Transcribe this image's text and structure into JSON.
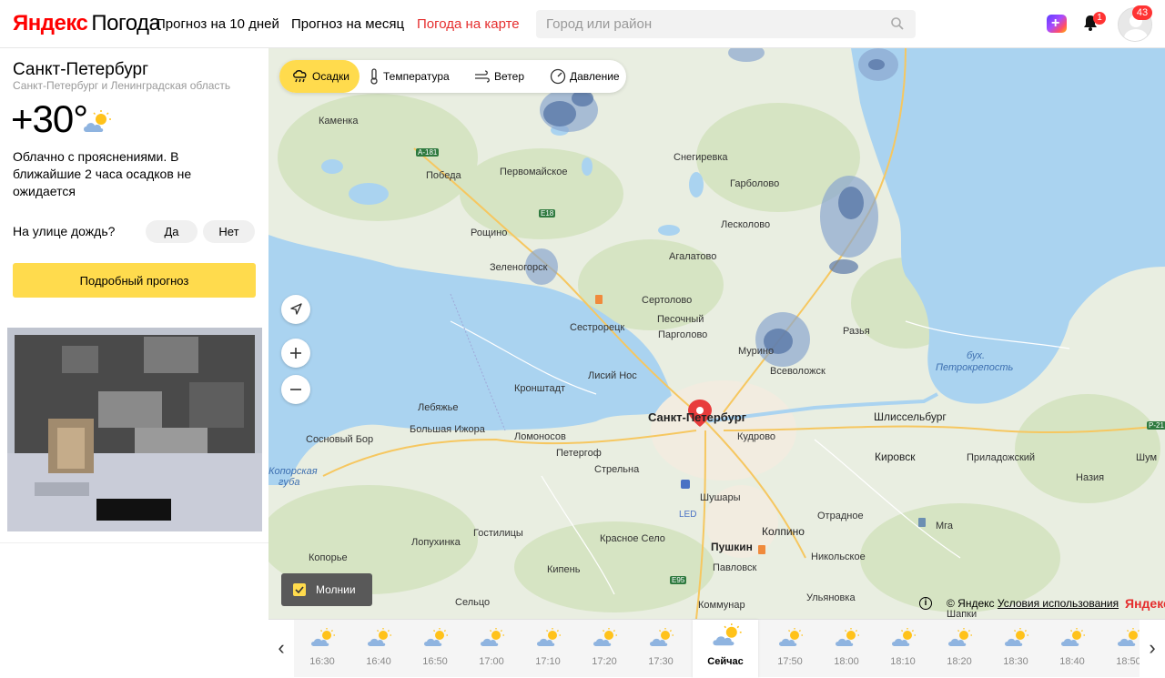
{
  "header": {
    "logo_brand": "Яндекс",
    "logo_service": "Погода",
    "nav": [
      {
        "label": "Прогноз на 10 дней",
        "active": false
      },
      {
        "label": "Прогноз на месяц",
        "active": false
      },
      {
        "label": "Погода на карте",
        "active": true
      }
    ],
    "search_placeholder": "Город или район",
    "bell_badge": "1",
    "avatar_badge": "43",
    "plus_icon": "plus-icon"
  },
  "sidebar": {
    "city": "Санкт-Петербург",
    "region": "Санкт-Петербург и Ленинградская область",
    "temperature": "+30°",
    "condition_icon": "cloud-sun-icon",
    "description": "Облачно с прояснениями. В ближайшие 2 часа осадков не ожидается",
    "rain_question": "На улице дождь?",
    "answer_yes": "Да",
    "answer_no": "Нет",
    "detailed_button": "Подробный прогноз"
  },
  "map": {
    "layers": [
      {
        "label": "Осадки",
        "icon": "rain-cloud-icon",
        "active": true
      },
      {
        "label": "Температура",
        "icon": "thermometer-icon",
        "active": false
      },
      {
        "label": "Ветер",
        "icon": "wind-icon",
        "active": false
      },
      {
        "label": "Давление",
        "icon": "gauge-icon",
        "active": false
      }
    ],
    "lightning_label": "Молнии",
    "lightning_checked": true,
    "copyright": "© Яндекс",
    "terms": "Условия использования",
    "logo": "Яндекс",
    "labels": {
      "kamenka": "Каменка",
      "a181": "A-181",
      "pobeda": "Победа",
      "pervomayskoe": "Первомайское",
      "snegirevka": "Снегиревка",
      "garbolovo": "Гарболово",
      "e18": "E18",
      "roshchino": "Рощино",
      "lesколово": "Лесколово",
      "agalatovo": "Агалатово",
      "zelenogorsk": "Зеленогорск",
      "sertolovo": "Сертолово",
      "pesochny": "Песочный",
      "sestroretsk": "Сестрорецк",
      "pargolovo": "Парголово",
      "murino": "Мурино",
      "razya": "Разья",
      "vsevolozhsk": "Всеволожск",
      "bukh1": "бух.",
      "bukh2": "Петрокрепость",
      "lisiy_nos": "Лисий Нос",
      "kronshtadt": "Кронштадт",
      "spb": "Санкт-Петербург",
      "shlisselburg": "Шлиссельбург",
      "r21": "Р-21",
      "lebyazhye": "Лебяжье",
      "bolshaya_izhora": "Большая Ижора",
      "lomonosov": "Ломоносов",
      "kudrovo": "Кудрово",
      "kirovsk": "Кировск",
      "priladozhsky": "Приладожский",
      "shum": "Шум",
      "sosnovy_bor": "Сосновый Бор",
      "petergof": "Петергоф",
      "strelna": "Стрельна",
      "koporskaya1": "Копорская",
      "koporskaya2": "губа",
      "nazia": "Назия",
      "shushary": "Шушары",
      "led": "LED",
      "otradnoe": "Отрадное",
      "mga": "Мга",
      "gostilitsy": "Гостилицы",
      "lopuhinka": "Лопухинка",
      "krasnoe_selo": "Красное Село",
      "kolpino": "Колпино",
      "pushkin": "Пушкин",
      "nikolskoe": "Никольское",
      "koporye": "Копорье",
      "kipen": "Кипень",
      "pavlovsk": "Павловск",
      "e95": "E95",
      "ulyanovka": "Ульяновка",
      "selco": "Сельцо",
      "kommunar": "Коммунар",
      "shapki": "Шапки"
    }
  },
  "timeline": {
    "slots": [
      {
        "time": "16:30",
        "icon": "cloud-sun-icon",
        "now": false
      },
      {
        "time": "16:40",
        "icon": "cloud-sun-icon",
        "now": false
      },
      {
        "time": "16:50",
        "icon": "cloud-sun-icon",
        "now": false
      },
      {
        "time": "17:00",
        "icon": "cloud-sun-icon",
        "now": false
      },
      {
        "time": "17:10",
        "icon": "cloud-sun-icon",
        "now": false
      },
      {
        "time": "17:20",
        "icon": "cloud-sun-icon",
        "now": false
      },
      {
        "time": "17:30",
        "icon": "cloud-sun-icon",
        "now": false
      },
      {
        "time": "Сейчас",
        "icon": "cloud-sun-icon",
        "now": true
      },
      {
        "time": "17:50",
        "icon": "cloud-sun-icon",
        "now": false
      },
      {
        "time": "18:00",
        "icon": "cloud-sun-icon",
        "now": false
      },
      {
        "time": "18:10",
        "icon": "cloud-sun-icon",
        "now": false
      },
      {
        "time": "18:20",
        "icon": "cloud-sun-icon",
        "now": false
      },
      {
        "time": "18:30",
        "icon": "cloud-sun-icon",
        "now": false
      },
      {
        "time": "18:40",
        "icon": "cloud-sun-icon",
        "now": false
      },
      {
        "time": "18:50",
        "icon": "cloud-sun-icon",
        "now": false
      }
    ]
  },
  "colors": {
    "accent_yellow": "#ffdb4d",
    "active_nav": "#e52e2e",
    "water": "#aad3f0",
    "land": "#e9eee1",
    "precip": "#5a78a8"
  }
}
